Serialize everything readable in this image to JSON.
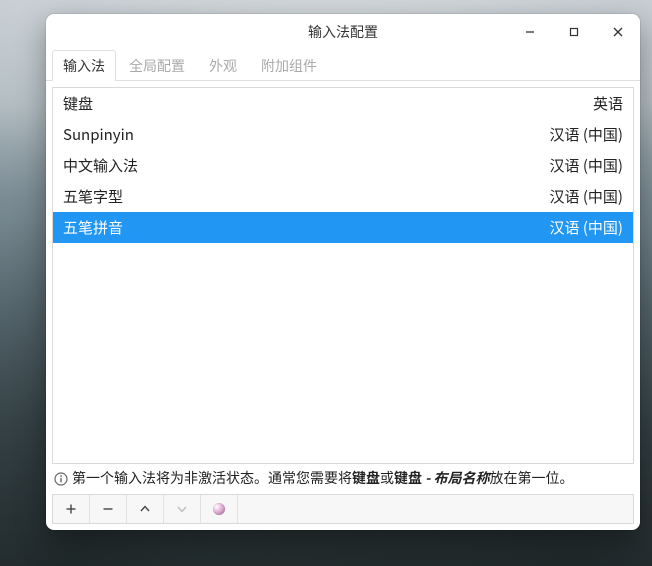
{
  "window": {
    "title": "输入法配置"
  },
  "tabs": [
    {
      "label": "输入法",
      "active": true
    },
    {
      "label": "全局配置",
      "active": false
    },
    {
      "label": "外观",
      "active": false
    },
    {
      "label": "附加组件",
      "active": false
    }
  ],
  "im_list": [
    {
      "name": "键盘",
      "lang": "英语",
      "selected": false
    },
    {
      "name": "Sunpinyin",
      "lang": "汉语 (中国)",
      "selected": false
    },
    {
      "name": "中文输入法",
      "lang": "汉语 (中国)",
      "selected": false
    },
    {
      "name": "五笔字型",
      "lang": "汉语 (中国)",
      "selected": false
    },
    {
      "name": "五笔拼音",
      "lang": "汉语 (中国)",
      "selected": true
    }
  ],
  "hint": {
    "p1": "第一个输入法将为非激活状态。通常您需要将",
    "b1": "键盘",
    "p2": "或",
    "b2": "键盘",
    "p3": " - ",
    "i1": "布局名称",
    "p4": "放在第一位。"
  },
  "toolbar": {
    "add_label": "add",
    "remove_label": "remove",
    "up_label": "move-up",
    "down_label": "move-down",
    "config_label": "configure",
    "kb_label": "keyboard-layout"
  }
}
